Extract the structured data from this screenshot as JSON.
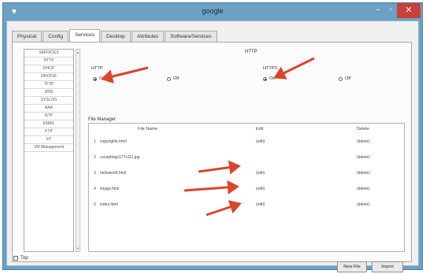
{
  "window": {
    "title": "google",
    "close_glyph": "✕",
    "minimize_glyph": "–",
    "maximize_glyph": "▫",
    "icon": "window-icon"
  },
  "tabs": [
    "Physical",
    "Config",
    "Services",
    "Desktop",
    "Attributes",
    "Software/Services"
  ],
  "active_tab": "Services",
  "services": [
    "SERVICES",
    "HTTP",
    "DHCP",
    "DHCPv6",
    "TFTP",
    "DNS",
    "SYSLOG",
    "AAA",
    "NTP",
    "EMAIL",
    "FTP",
    "IoT",
    "VM Management"
  ],
  "http": {
    "section_title": "HTTP",
    "http_label": "HTTP",
    "https_label": "HTTPS",
    "on_label": "On",
    "off_label": "Off",
    "http_state": "On",
    "https_state": "On"
  },
  "file_manager": {
    "label": "File Manager",
    "columns": [
      "File Name",
      "Edit",
      "Delete"
    ],
    "rows": [
      {
        "num": "1",
        "name": "copyrights.html",
        "edit": "(edit)",
        "delete": "(delete)"
      },
      {
        "num": "2",
        "name": "cscoptlogo177x111.jpg",
        "edit": "",
        "delete": "(delete)"
      },
      {
        "num": "3",
        "name": "helloworld.html",
        "edit": "(edit)",
        "delete": "(delete)"
      },
      {
        "num": "4",
        "name": "image.html",
        "edit": "(edit)",
        "delete": "(delete)"
      },
      {
        "num": "5",
        "name": "index.html",
        "edit": "(edit)",
        "delete": "(delete)"
      }
    ]
  },
  "buttons": {
    "new_file": "New File",
    "import": "Import"
  },
  "top_checkbox": {
    "label": "Top",
    "checked": false
  },
  "colors": {
    "titlebar": "#6aa1c4",
    "close": "#c7403a",
    "annotation_arrow": "#d9462a"
  }
}
